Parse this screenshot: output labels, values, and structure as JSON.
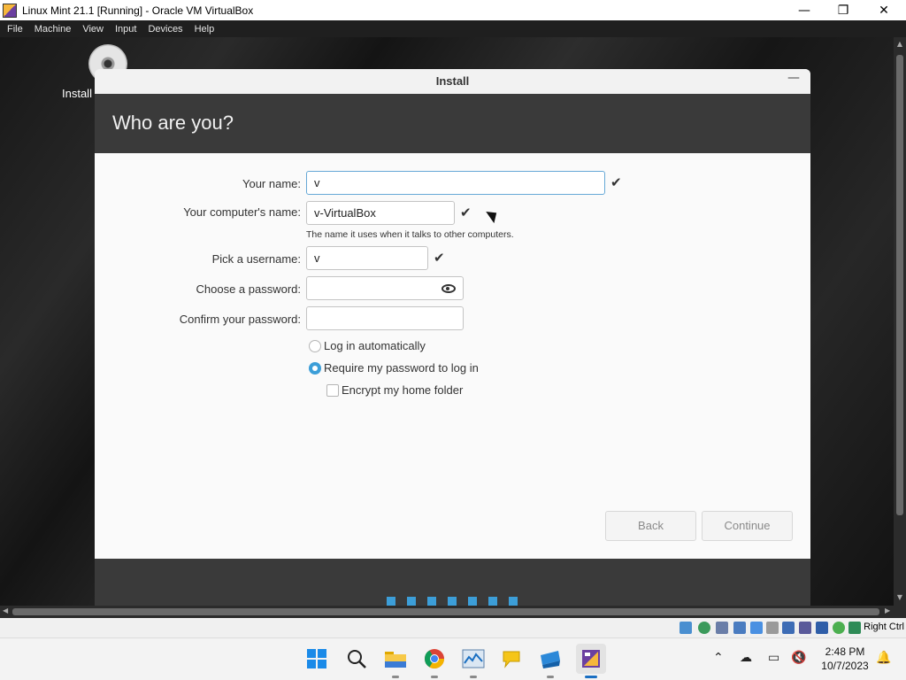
{
  "host_window": {
    "title": "Linux Mint 21.1 [Running] - Oracle VM VirtualBox",
    "minimize_glyph": "—",
    "maximize_glyph": "❐",
    "close_glyph": "✕",
    "menu": [
      "File",
      "Machine",
      "View",
      "Input",
      "Devices",
      "Help"
    ]
  },
  "desktop": {
    "install_icon_label": "Install"
  },
  "installer": {
    "window_title": "Install",
    "page_heading": "Who are you?",
    "form": {
      "your_name_label": "Your name:",
      "your_name_value": "v",
      "computer_name_label": "Your computer's name:",
      "computer_name_value": "v-VirtualBox",
      "computer_name_hint": "The name it uses when it talks to other computers.",
      "username_label": "Pick a username:",
      "username_value": "v",
      "password_label": "Choose a password:",
      "password_value": "",
      "confirm_label": "Confirm your password:",
      "confirm_value": "",
      "check_glyph": "✔",
      "login_options": {
        "auto_login": "Log in automatically",
        "require_password": "Require my password to log in",
        "selected": "require_password",
        "encrypt_home": "Encrypt my home folder",
        "encrypt_checked": false
      }
    },
    "buttons": {
      "back": "Back",
      "continue": "Continue"
    },
    "progress_dots": 7
  },
  "vbox_status": {
    "host_key": "Right Ctrl"
  },
  "taskbar": {
    "time": "2:48 PM",
    "date": "10/7/2023",
    "apps": [
      "start",
      "search",
      "file-explorer",
      "chrome",
      "task-manager",
      "notes",
      "vscode",
      "virtualbox"
    ],
    "active_app": "virtualbox"
  },
  "colors": {
    "accent": "#3c9ed8",
    "banner": "#3a3a3a"
  }
}
